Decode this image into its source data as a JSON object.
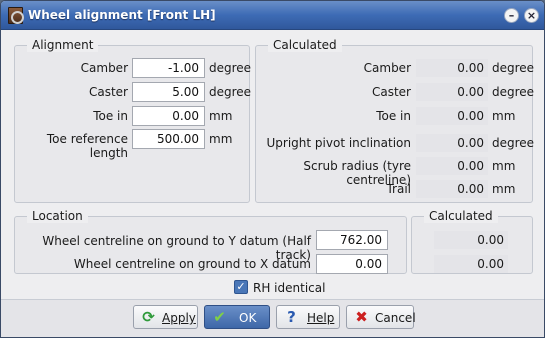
{
  "window": {
    "title": "Wheel alignment [Front LH]"
  },
  "alignment": {
    "title": "Alignment",
    "rows": [
      {
        "label": "Camber",
        "value": "-1.00",
        "unit": "degree"
      },
      {
        "label": "Caster",
        "value": "5.00",
        "unit": "degree"
      },
      {
        "label": "Toe in",
        "value": "0.00",
        "unit": "mm"
      },
      {
        "label": "Toe reference length",
        "value": "500.00",
        "unit": "mm"
      }
    ]
  },
  "calculated_alignment": {
    "title": "Calculated",
    "rows": [
      {
        "label": "Camber",
        "value": "0.00",
        "unit": "degree"
      },
      {
        "label": "Caster",
        "value": "0.00",
        "unit": "degree"
      },
      {
        "label": "Toe in",
        "value": "0.00",
        "unit": "mm"
      },
      {
        "label": "Upright pivot inclination",
        "value": "0.00",
        "unit": "degree"
      },
      {
        "label": "Scrub radius (tyre centreline)",
        "value": "0.00",
        "unit": "mm"
      },
      {
        "label": "Trail",
        "value": "0.00",
        "unit": "mm"
      }
    ]
  },
  "location": {
    "title": "Location",
    "rows": [
      {
        "label": "Wheel centreline on ground to Y datum (Half track)",
        "value": "762.00"
      },
      {
        "label": "Wheel centreline on ground to X datum",
        "value": "0.00"
      }
    ]
  },
  "calculated_location": {
    "title": "Calculated",
    "values": [
      "0.00",
      "0.00"
    ]
  },
  "rh_identical": {
    "label": "RH identical",
    "checked": true
  },
  "buttons": {
    "apply": "Apply",
    "ok": "OK",
    "help": "Help",
    "cancel": "Cancel"
  },
  "icons": {
    "app": "wheel-alignment-icon",
    "apply": "refresh-arrows-icon",
    "ok": "checkmark-icon",
    "help": "question-mark-icon",
    "cancel": "red-x-icon"
  }
}
